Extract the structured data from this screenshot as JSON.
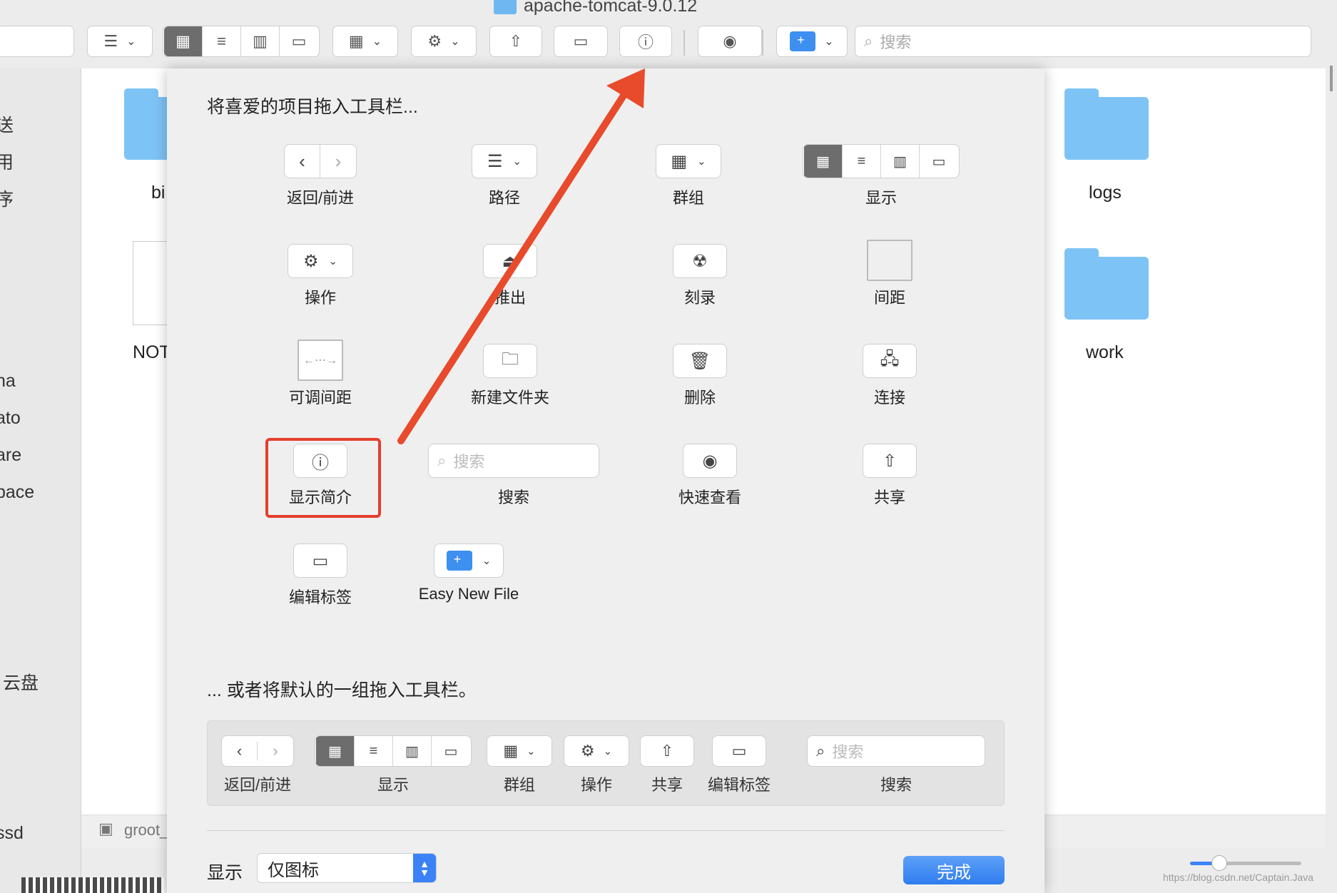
{
  "window": {
    "title": "apache-tomcat-9.0.12"
  },
  "toolbar": {
    "search_placeholder": "搜索",
    "path_icon": "list-icon",
    "chevron": "⌄"
  },
  "sidebar": {
    "items": [
      "送",
      "用",
      "序",
      "na",
      "ato",
      "are",
      "pace",
      "云盘",
      "ssd"
    ]
  },
  "files": {
    "items": [
      "bi",
      "NOT",
      "logs",
      "work"
    ]
  },
  "statusbar": {
    "path": "groot_"
  },
  "sheet": {
    "heading": "将喜爱的项目拖入工具栏...",
    "items": {
      "back_forward": "返回/前进",
      "path": "路径",
      "group": "群组",
      "view": "显示",
      "action": "操作",
      "eject": "推出",
      "burn": "刻录",
      "space": "间距",
      "flexible_space": "可调间距",
      "new_folder": "新建文件夹",
      "delete": "删除",
      "connect": "连接",
      "get_info": "显示简介",
      "search": "搜索",
      "search_placeholder": "搜索",
      "quick_look": "快速查看",
      "share": "共享",
      "edit_tags": "编辑标签",
      "easy_new_file": "Easy New File"
    },
    "default_heading": "... 或者将默认的一组拖入工具栏。",
    "default_items": {
      "back_forward": "返回/前进",
      "view": "显示",
      "group": "群组",
      "action": "操作",
      "share": "共享",
      "edit_tags": "编辑标签",
      "search": "搜索",
      "search_placeholder": "搜索"
    },
    "show_label": "显示",
    "show_value": "仅图标",
    "done_label": "完成"
  },
  "watermark": "https://blog.csdn.net/Captain.Java",
  "colors": {
    "accent": "#3b82f6",
    "highlight": "#e53e2d",
    "folder": "#7ec3f5"
  }
}
